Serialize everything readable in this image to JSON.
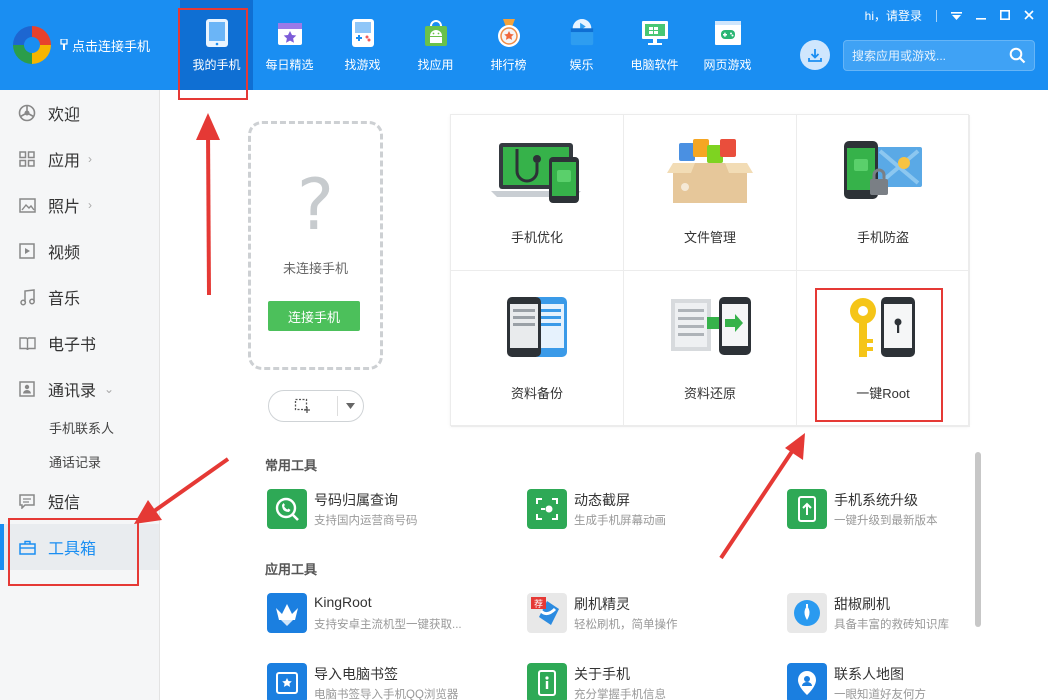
{
  "app": {
    "connect_label": "点击连接手机",
    "greeting": "hi，请登录",
    "search_placeholder": "搜索应用或游戏..."
  },
  "nav": [
    {
      "label": "我的手机",
      "icon": "phone-icon",
      "active": true
    },
    {
      "label": "每日精选",
      "icon": "calendar-star-icon"
    },
    {
      "label": "找游戏",
      "icon": "gameboy-icon"
    },
    {
      "label": "找应用",
      "icon": "android-bag-icon"
    },
    {
      "label": "排行榜",
      "icon": "medal-icon"
    },
    {
      "label": "娱乐",
      "icon": "play-box-icon"
    },
    {
      "label": "电脑软件",
      "icon": "monitor-icon"
    },
    {
      "label": "网页游戏",
      "icon": "browser-game-icon"
    }
  ],
  "sidebar": {
    "items": [
      {
        "label": "欢迎",
        "icon": "welcome-icon"
      },
      {
        "label": "应用",
        "icon": "grid-icon",
        "chevron": "›"
      },
      {
        "label": "照片",
        "icon": "photo-icon",
        "chevron": "›"
      },
      {
        "label": "视频",
        "icon": "video-icon"
      },
      {
        "label": "音乐",
        "icon": "music-icon"
      },
      {
        "label": "电子书",
        "icon": "book-icon"
      },
      {
        "label": "通讯录",
        "icon": "contacts-icon",
        "chevron": "⌄"
      },
      {
        "label": "短信",
        "icon": "sms-icon"
      },
      {
        "label": "工具箱",
        "icon": "toolbox-icon",
        "active": true
      }
    ],
    "sub_items": [
      "手机联系人",
      "通话记录"
    ]
  },
  "phone_card": {
    "question": "?",
    "status": "未连接手机",
    "connect_button": "连接手机"
  },
  "features": [
    {
      "label": "手机优化",
      "icon": "stethoscope-laptop-icon"
    },
    {
      "label": "文件管理",
      "icon": "file-box-icon"
    },
    {
      "label": "手机防盗",
      "icon": "phone-lock-map-icon"
    },
    {
      "label": "资料备份",
      "icon": "backup-phones-icon"
    },
    {
      "label": "资料还原",
      "icon": "restore-phone-icon"
    },
    {
      "label": "一键Root",
      "icon": "key-phone-icon"
    }
  ],
  "sections": {
    "common_title": "常用工具",
    "app_title": "应用工具"
  },
  "common_tools": [
    {
      "name": "号码归属查询",
      "desc": "支持国内运营商号码",
      "icon": "phone-search-icon",
      "color": "#2ea956"
    },
    {
      "name": "动态截屏",
      "desc": "生成手机屏幕动画",
      "icon": "screen-capture-icon",
      "color": "#2ea956"
    },
    {
      "name": "手机系统升级",
      "desc": "一键升级到最新版本",
      "icon": "system-upgrade-icon",
      "color": "#2ea956"
    }
  ],
  "app_tools": [
    {
      "name": "KingRoot",
      "desc": "支持安卓主流机型一键获取...",
      "icon": "crown-icon",
      "color": "#1b7fe0"
    },
    {
      "name": "刷机精灵",
      "desc": "轻松刷机，简单操作",
      "icon": "flash-sprite-icon",
      "color": "#e8e8e8",
      "badge": "荐"
    },
    {
      "name": "甜椒刷机",
      "desc": "具备丰富的救砖知识库",
      "icon": "pepper-flash-icon",
      "color": "#e8e8e8"
    },
    {
      "name": "导入电脑书签",
      "desc": "电脑书签导入手机QQ浏览器",
      "icon": "bookmark-import-icon",
      "color": "#1b7fe0"
    },
    {
      "name": "关于手机",
      "desc": "充分掌握手机信息",
      "icon": "about-phone-icon",
      "color": "#2ea956"
    },
    {
      "name": "联系人地图",
      "desc": "一眼知道好友何方",
      "icon": "contact-map-icon",
      "color": "#1b7fe0"
    }
  ],
  "colors": {
    "topbar": "#1a8ef2",
    "nav_active": "#0f6fd3",
    "accent_green": "#4cc05b",
    "annotation_red": "#e53935"
  }
}
